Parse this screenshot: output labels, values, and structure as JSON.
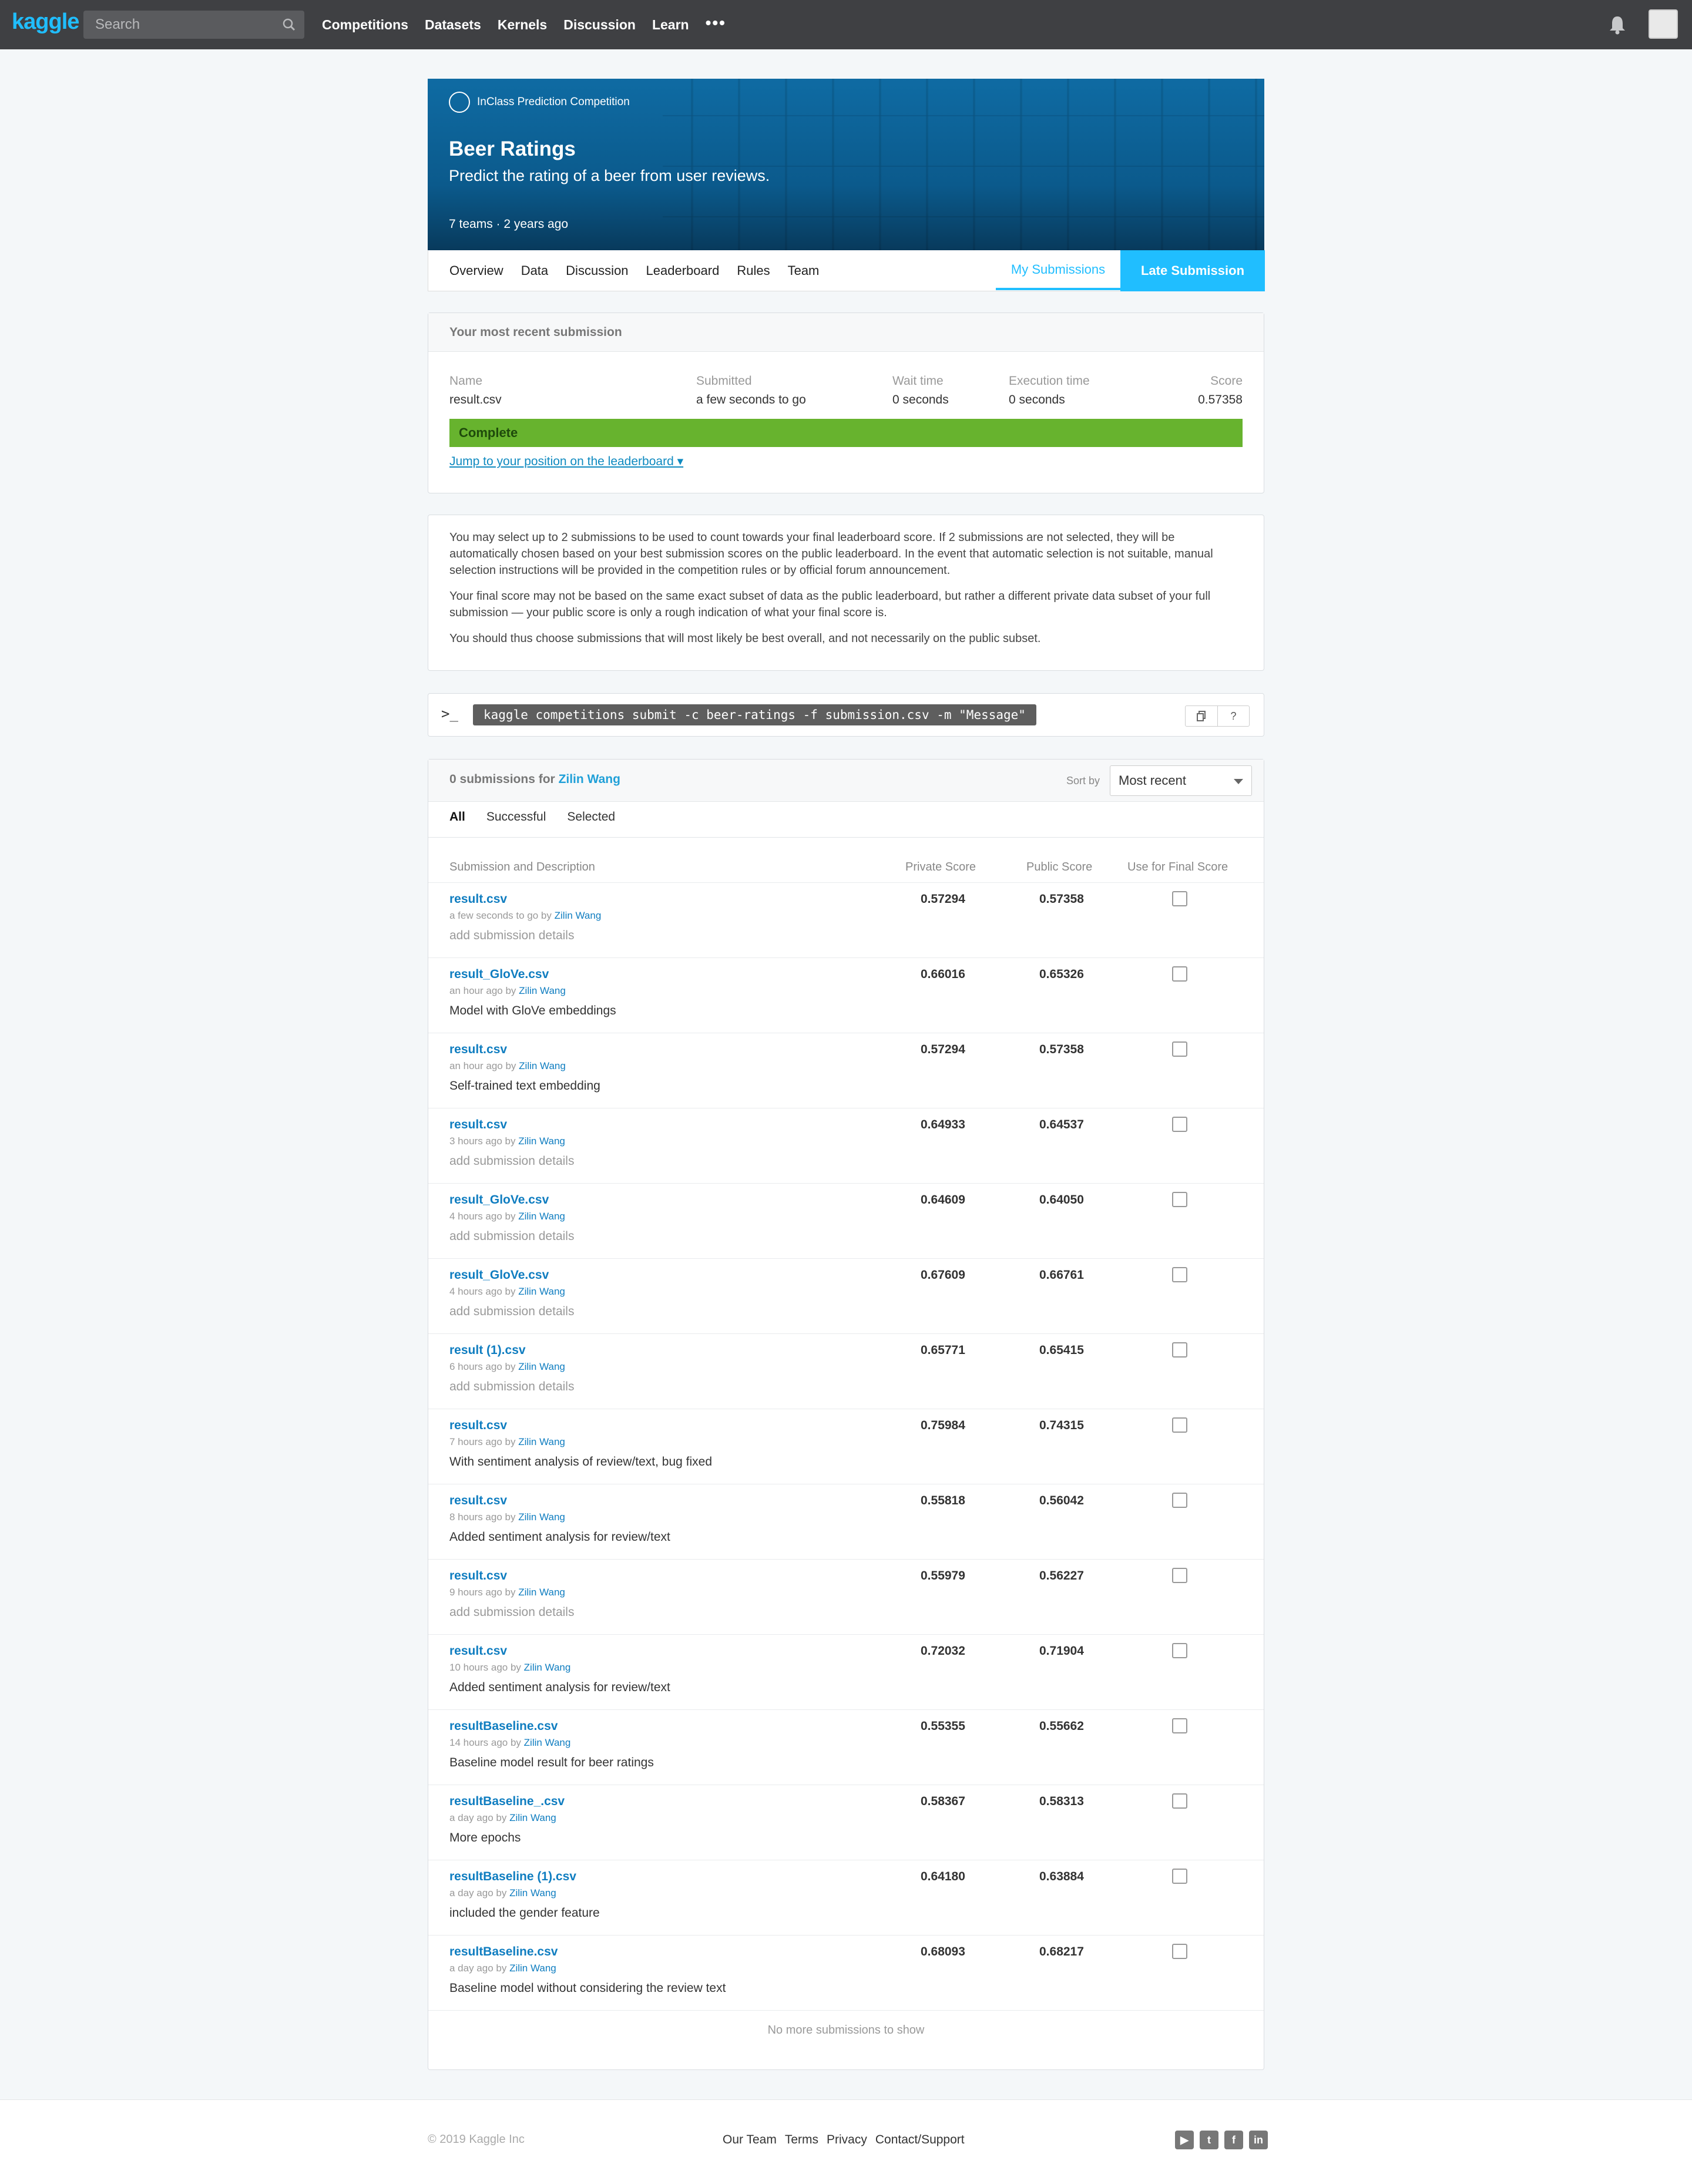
{
  "topbar": {
    "logo": "kaggle",
    "search_placeholder": "Search",
    "nav": [
      "Competitions",
      "Datasets",
      "Kernels",
      "Discussion",
      "Learn"
    ],
    "more": "•••"
  },
  "header": {
    "type": "InClass Prediction Competition",
    "title": "Beer Ratings",
    "subtitle": "Predict the rating of a beer from user reviews.",
    "meta": "7 teams · 2 years ago"
  },
  "tabs": {
    "items": [
      "Overview",
      "Data",
      "Discussion",
      "Leaderboard",
      "Rules",
      "Team"
    ],
    "my_submissions": "My Submissions",
    "late_submission": "Late Submission"
  },
  "recent": {
    "heading": "Your most recent submission",
    "name_label": "Name",
    "name": "result.csv",
    "submitted_label": "Submitted",
    "submitted": "a few seconds to go",
    "wait_label": "Wait time",
    "wait": "0 seconds",
    "exec_label": "Execution time",
    "exec": "0 seconds",
    "score_label": "Score",
    "score": "0.57358",
    "status": "Complete",
    "jump": "Jump to your position on the leaderboard ▾"
  },
  "info": {
    "p1": "You may select up to 2 submissions to be used to count towards your final leaderboard score. If 2 submissions are not selected, they will be automatically chosen based on your best submission scores on the public leaderboard. In the event that automatic selection is not suitable, manual selection instructions will be provided in the competition rules or by official forum announcement.",
    "p2": "Your final score may not be based on the same exact subset of data as the public leaderboard, but rather a different private data subset of your full submission — your public score is only a rough indication of what your final score is.",
    "p3": "You should thus choose submissions that will most likely be best overall, and not necessarily on the public subset."
  },
  "cli": {
    "prompt": ">_",
    "command": "kaggle competitions submit -c beer-ratings -f submission.csv -m \"Message\"",
    "help": "?"
  },
  "subs": {
    "count": "0 submissions for",
    "user": "Zilin Wang",
    "sort_label": "Sort by",
    "sort_value": "Most recent",
    "filters": [
      "All",
      "Successful",
      "Selected"
    ],
    "col_desc": "Submission and Description",
    "col_private": "Private Score",
    "col_public": "Public Score",
    "col_final": "Use for Final Score",
    "rows": [
      {
        "file": "result.csv",
        "when": "a few seconds to go by",
        "by": "Zilin Wang",
        "desc": "add submission details",
        "ph": true,
        "priv": "0.57294",
        "pub": "0.57358"
      },
      {
        "file": "result_GloVe.csv",
        "when": "an hour ago by",
        "by": "Zilin Wang",
        "desc": "Model with GloVe embeddings",
        "ph": false,
        "priv": "0.66016",
        "pub": "0.65326"
      },
      {
        "file": "result.csv",
        "when": "an hour ago by",
        "by": "Zilin Wang",
        "desc": "Self-trained text embedding",
        "ph": false,
        "priv": "0.57294",
        "pub": "0.57358"
      },
      {
        "file": "result.csv",
        "when": "3 hours ago by",
        "by": "Zilin Wang",
        "desc": "add submission details",
        "ph": true,
        "priv": "0.64933",
        "pub": "0.64537"
      },
      {
        "file": "result_GloVe.csv",
        "when": "4 hours ago by",
        "by": "Zilin Wang",
        "desc": "add submission details",
        "ph": true,
        "priv": "0.64609",
        "pub": "0.64050"
      },
      {
        "file": "result_GloVe.csv",
        "when": "4 hours ago by",
        "by": "Zilin Wang",
        "desc": "add submission details",
        "ph": true,
        "priv": "0.67609",
        "pub": "0.66761"
      },
      {
        "file": "result (1).csv",
        "when": "6 hours ago by",
        "by": "Zilin Wang",
        "desc": "add submission details",
        "ph": true,
        "priv": "0.65771",
        "pub": "0.65415"
      },
      {
        "file": "result.csv",
        "when": "7 hours ago by",
        "by": "Zilin Wang",
        "desc": "With sentiment analysis of review/text, bug fixed",
        "ph": false,
        "priv": "0.75984",
        "pub": "0.74315"
      },
      {
        "file": "result.csv",
        "when": "8 hours ago by",
        "by": "Zilin Wang",
        "desc": "Added sentiment analysis for review/text",
        "ph": false,
        "priv": "0.55818",
        "pub": "0.56042"
      },
      {
        "file": "result.csv",
        "when": "9 hours ago by",
        "by": "Zilin Wang",
        "desc": "add submission details",
        "ph": true,
        "priv": "0.55979",
        "pub": "0.56227"
      },
      {
        "file": "result.csv",
        "when": "10 hours ago by",
        "by": "Zilin Wang",
        "desc": "Added sentiment analysis for review/text",
        "ph": false,
        "priv": "0.72032",
        "pub": "0.71904"
      },
      {
        "file": "resultBaseline.csv",
        "when": "14 hours ago by",
        "by": "Zilin Wang",
        "desc": "Baseline model result for beer ratings",
        "ph": false,
        "priv": "0.55355",
        "pub": "0.55662"
      },
      {
        "file": "resultBaseline_.csv",
        "when": "a day ago by",
        "by": "Zilin Wang",
        "desc": "More epochs",
        "ph": false,
        "priv": "0.58367",
        "pub": "0.58313"
      },
      {
        "file": "resultBaseline (1).csv",
        "when": "a day ago by",
        "by": "Zilin Wang",
        "desc": "included the gender feature",
        "ph": false,
        "priv": "0.64180",
        "pub": "0.63884"
      },
      {
        "file": "resultBaseline.csv",
        "when": "a day ago by",
        "by": "Zilin Wang",
        "desc": "Baseline model without considering the review text",
        "ph": false,
        "priv": "0.68093",
        "pub": "0.68217"
      }
    ],
    "no_more": "No more submissions to show"
  },
  "footer": {
    "copyright": "© 2019 Kaggle Inc",
    "links": [
      "Our Team",
      "Terms",
      "Privacy",
      "Contact/Support"
    ],
    "social": [
      "youtube-icon",
      "twitter-icon",
      "facebook-icon",
      "linkedin-icon"
    ]
  }
}
